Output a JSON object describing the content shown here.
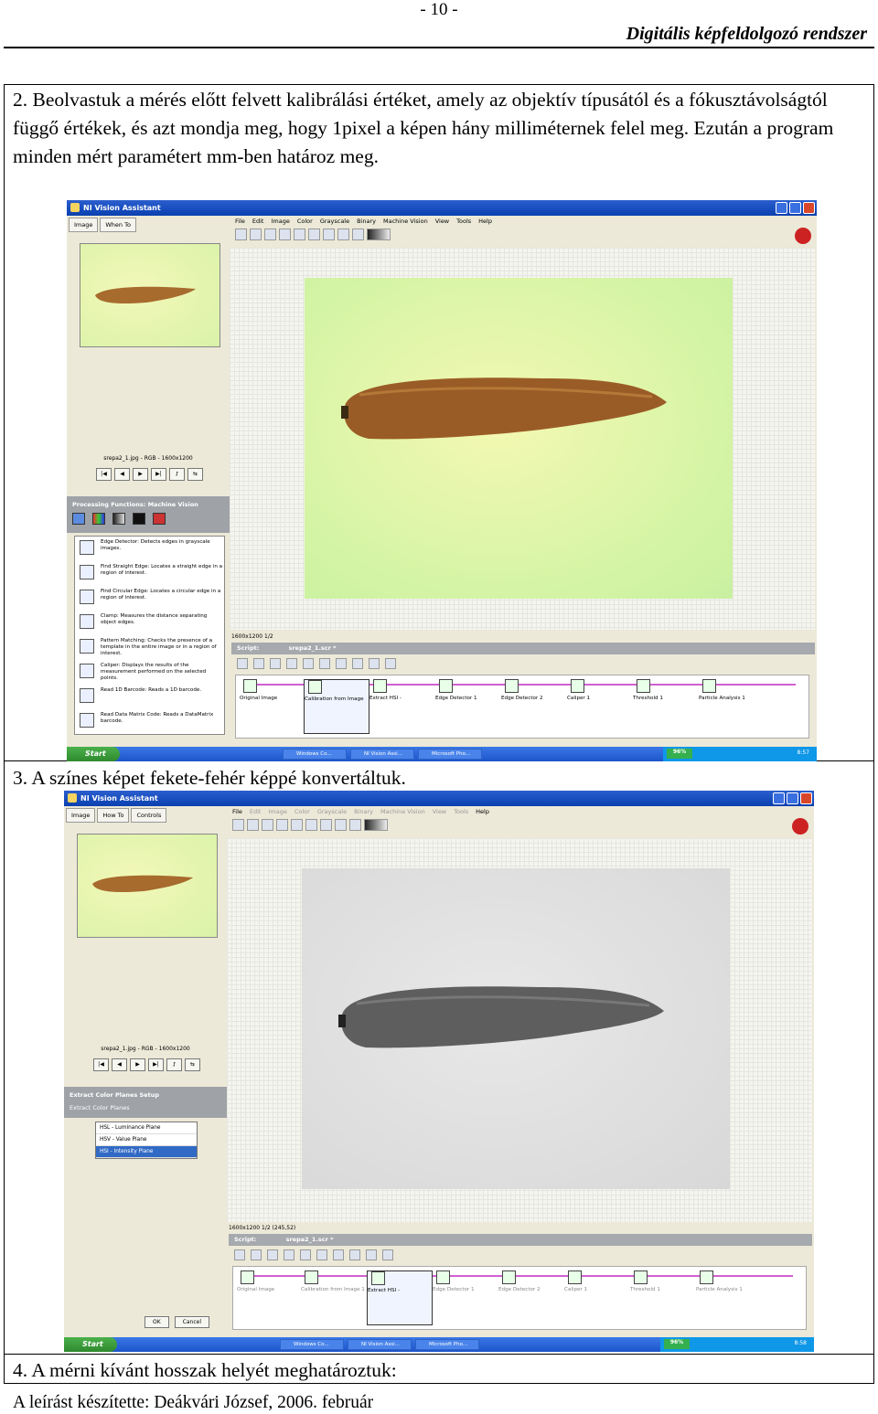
{
  "header": {
    "page_number": "- 10 -",
    "title": "Digitális képfeldolgozó rendszer"
  },
  "steps": {
    "step2": "2. Beolvastuk a mérés előtt felvett kalibrálási értéket, amely az objektív típusától és a fókusztávolságtól függő értékek, és azt mondja meg, hogy 1pixel a képen hány milliméternek felel meg. Ezután a program minden mért paramétert mm-ben határoz meg.",
    "step3": "3. A színes képet fekete-fehér képpé konvertáltuk.",
    "step4": "4. A mérni kívánt hosszak helyét meghatároztuk:"
  },
  "footer": "A leírást készítette: Deákvári József, 2006. február",
  "app": {
    "title": "NI Vision Assistant",
    "menu": [
      "File",
      "Edit",
      "Image",
      "Color",
      "Grayscale",
      "Binary",
      "Machine Vision",
      "View",
      "Tools",
      "Help"
    ],
    "image_info": "srepa2_1.jpg - RGB - 1600x1200",
    "script_name": "srepa2_1.scr *",
    "script_label": "Script:",
    "nav_buttons": [
      "|◀",
      "◀",
      "▶",
      "▶|",
      "⮥",
      "⇆"
    ],
    "taskbar": {
      "start": "Start",
      "tasks": [
        "Windows Co...",
        "NI Vision Assi...",
        "Microsoft Pho..."
      ],
      "battery": "96%"
    }
  },
  "screenshot1": {
    "tabs": [
      "Image",
      "When To"
    ],
    "panel_title": "Processing Functions: Machine Vision",
    "functions": [
      "Edge Detector: Detects edges in grayscale images.",
      "Find Straight Edge: Locates a straight edge in a region of interest.",
      "Find Circular Edge: Locates a circular edge in a region of interest.",
      "Clamp: Measures the distance separating object edges.",
      "Pattern Matching: Checks the presence of a template in the entire image or in a region of interest.",
      "Caliper: Displays the results of the measurement performed on the selected points.",
      "Read 1D Barcode: Reads a 1D barcode.",
      "Read Data Matrix Code: Reads a DataMatrix barcode."
    ],
    "status": "1600x1200 1/2",
    "steps": [
      "Original Image",
      "Calibration from Image",
      "Extract HSI -",
      "Edge Detector 1",
      "Edge Detector 2",
      "Caliper 1",
      "Threshold 1",
      "Particle Analysis 1"
    ],
    "clock": "8:57"
  },
  "screenshot2": {
    "tabs": [
      "Image",
      "How To",
      "Controls"
    ],
    "panel_title": "Extract Color Planes Setup",
    "sub_title": "Extract Color Planes",
    "planes": [
      "HSL - Luminance Plane",
      "HSV - Value Plane",
      "HSI - Intensity Plane"
    ],
    "status": "1600x1200 1/2    (245,52)",
    "steps": [
      "Original Image",
      "Calibration from Image 1",
      "Extract HSI -",
      "Edge Detector 1",
      "Edge Detector 2",
      "Caliper 1",
      "Threshold 1",
      "Particle Analysis 1"
    ],
    "ok": "OK",
    "cancel": "Cancel",
    "clock": "8:58"
  }
}
